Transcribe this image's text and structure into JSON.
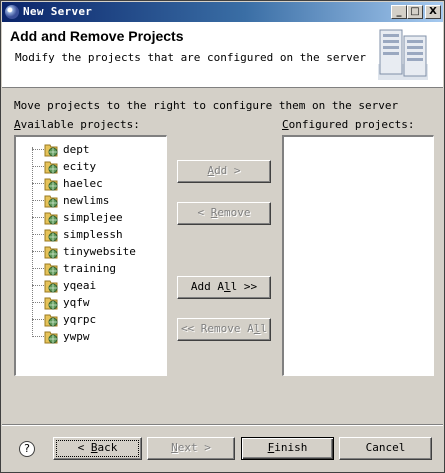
{
  "window": {
    "title": "New Server",
    "controls": {
      "minimize": "_",
      "maximize": "□",
      "close": "X"
    }
  },
  "banner": {
    "title": "Add and Remove Projects",
    "description": "Modify the projects that are configured on the server"
  },
  "instruction": "Move projects to the right to configure them on the server",
  "available": {
    "label_mnemonic": "A",
    "label_rest": "vailable projects:",
    "projects": [
      "dept",
      "ecity",
      "haelec",
      "newlims",
      "simplejee",
      "simplessh",
      "tinywebsite",
      "training",
      "yqeai",
      "yqfw",
      "yqrpc",
      "ywpw"
    ]
  },
  "configured": {
    "label_mnemonic": "C",
    "label_rest": "onfigured projects:",
    "projects": []
  },
  "buttons": {
    "add_mnemonic": "A",
    "add_rest": "dd >",
    "remove_pre": "< ",
    "remove_mnemonic": "R",
    "remove_rest": "emove",
    "addall_pre": "Add A",
    "addall_mnemonic": "l",
    "addall_rest": "l >>",
    "removeall_pre": "<< Remove A",
    "removeall_mnemonic": "l",
    "removeall_rest": "l",
    "back_pre": "< ",
    "back_mnemonic": "B",
    "back_rest": "ack",
    "next_mnemonic": "N",
    "next_rest": "ext >",
    "finish_mnemonic": "F",
    "finish_rest": "inish",
    "cancel": "Cancel",
    "help": "?"
  },
  "icons": {
    "app": "eclipse-icon",
    "server": "server-icon",
    "project": "web-project-icon",
    "help": "help-icon"
  },
  "colors": {
    "titlebar_start": "#0a246a",
    "titlebar_end": "#a6caf0",
    "dialog_bg": "#d4d0c8"
  }
}
